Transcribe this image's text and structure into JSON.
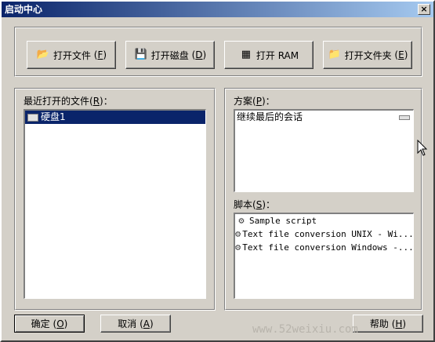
{
  "window": {
    "title": "启动中心",
    "close_glyph": "×"
  },
  "toolbar": {
    "open_file": {
      "label": "打开文件",
      "key": "F",
      "icon": "folder-open-icon",
      "glyph": "📂"
    },
    "open_disk": {
      "label": "打开磁盘",
      "key": "D",
      "icon": "disk-icon",
      "glyph": "💾"
    },
    "open_ram": {
      "label": "打开 RAM",
      "key": "",
      "icon": "ram-icon",
      "glyph": "▦"
    },
    "open_folder": {
      "label": "打开文件夹",
      "key": "E",
      "icon": "folder-icon",
      "glyph": "📁"
    }
  },
  "recent": {
    "label": "最近打开的文件",
    "key": "R",
    "items": [
      {
        "text": "硬盘1",
        "selected": true
      }
    ]
  },
  "scheme": {
    "label": "方案",
    "key": "P",
    "items": [
      {
        "text": "继续最后的会话"
      }
    ]
  },
  "scripts": {
    "label": "脚本",
    "key": "S",
    "items": [
      {
        "text": "Sample script"
      },
      {
        "text": "Text file conversion UNIX - Wi..."
      },
      {
        "text": "Text file conversion Windows -..."
      }
    ]
  },
  "footer": {
    "ok": {
      "label": "确定",
      "key": "O"
    },
    "cancel": {
      "label": "取消",
      "key": "A"
    },
    "help": {
      "label": "帮助",
      "key": "H"
    }
  },
  "watermark": "www.52weixiu.com"
}
